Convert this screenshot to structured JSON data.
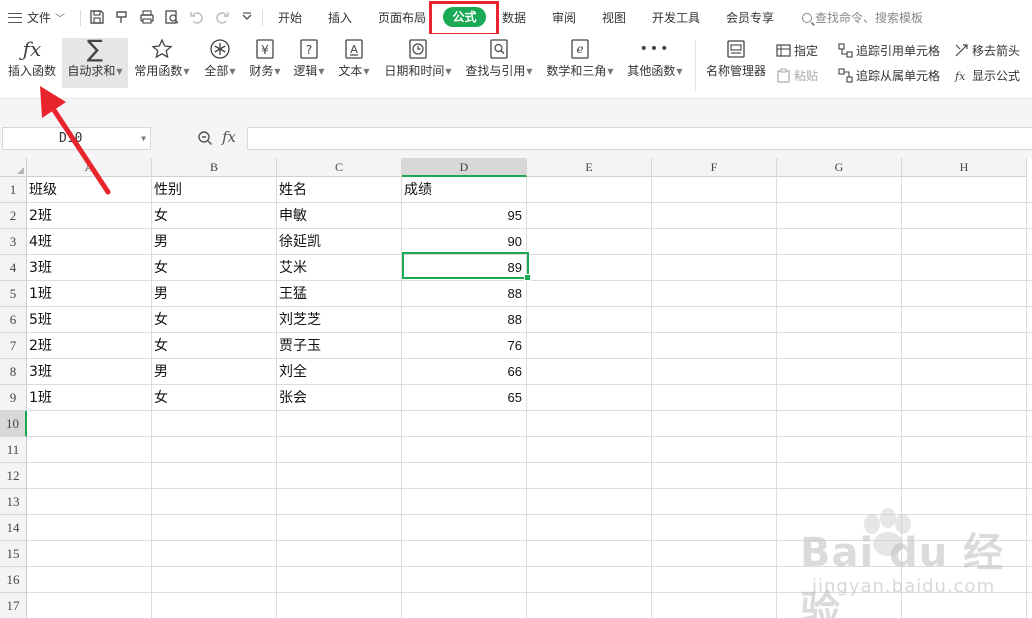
{
  "menu": {
    "file_label": "文件",
    "tabs": [
      "开始",
      "插入",
      "页面布局",
      "公式",
      "数据",
      "审阅",
      "视图",
      "开发工具",
      "会员专享"
    ],
    "active_tab": "公式",
    "search_placeholder": "查找命令、搜索模板"
  },
  "ribbon": {
    "buttons": [
      {
        "label": "插入函数",
        "icon": "fx-icon",
        "dropdown": false
      },
      {
        "label": "自动求和",
        "icon": "sigma-icon",
        "dropdown": true
      },
      {
        "label": "常用函数",
        "icon": "star-icon",
        "dropdown": true
      },
      {
        "label": "全部",
        "icon": "asterisk-circle-icon",
        "dropdown": true
      },
      {
        "label": "财务",
        "icon": "yen-icon",
        "dropdown": true
      },
      {
        "label": "逻辑",
        "icon": "question-icon",
        "dropdown": true
      },
      {
        "label": "文本",
        "icon": "text-a-icon",
        "dropdown": true
      },
      {
        "label": "日期和时间",
        "icon": "clock-icon",
        "dropdown": true
      },
      {
        "label": "查找与引用",
        "icon": "lookup-icon",
        "dropdown": true
      },
      {
        "label": "数学和三角",
        "icon": "math-e-icon",
        "dropdown": true
      },
      {
        "label": "其他函数",
        "icon": "more-dots-icon",
        "dropdown": true
      },
      {
        "label": "名称管理器",
        "icon": "name-manager-icon",
        "dropdown": false
      }
    ],
    "small": {
      "specify": "指定",
      "paste": "粘贴",
      "trace_precedents": "追踪引用单元格",
      "trace_dependents": "追踪从属单元格",
      "remove_arrows": "移去箭头",
      "show_formulas": "显示公式"
    }
  },
  "formula_bar": {
    "name_box": "D10",
    "fx_label": "fx",
    "formula": ""
  },
  "sheet": {
    "columns": [
      "A",
      "B",
      "C",
      "D",
      "E",
      "F",
      "G",
      "H"
    ],
    "selected_column": "D",
    "row_numbers": [
      "1",
      "2",
      "3",
      "4",
      "5",
      "6",
      "7",
      "8",
      "9",
      "10",
      "11",
      "12",
      "13",
      "14",
      "15",
      "16",
      "17"
    ],
    "selected_row": "10",
    "rows": [
      [
        "班级",
        "性别",
        "姓名",
        "成绩"
      ],
      [
        "2班",
        "女",
        "申敏",
        "95"
      ],
      [
        "4班",
        "男",
        "徐延凯",
        "90"
      ],
      [
        "3班",
        "女",
        "艾米",
        "89"
      ],
      [
        "1班",
        "男",
        "王猛",
        "88"
      ],
      [
        "5班",
        "女",
        "刘芝芝",
        "88"
      ],
      [
        "2班",
        "女",
        "贾子玉",
        "76"
      ],
      [
        "3班",
        "男",
        "刘全",
        "66"
      ],
      [
        "1班",
        "女",
        "张会",
        "65"
      ]
    ]
  },
  "watermark": {
    "brand": "Bai du 经验",
    "url": "jingyan.baidu.com"
  },
  "colors": {
    "accent": "#1aaa55",
    "highlight_box": "#e8242d"
  }
}
